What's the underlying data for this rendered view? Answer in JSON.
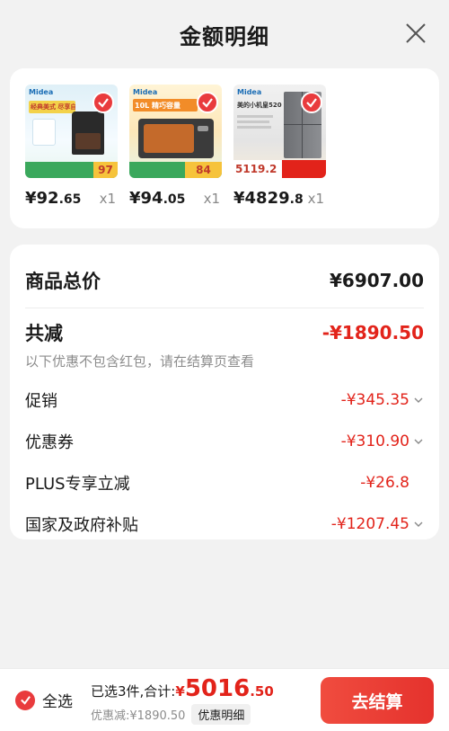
{
  "header": {
    "title": "金额明细"
  },
  "products": [
    {
      "price_int": "¥92",
      "price_dec": ".65",
      "qty": "x1",
      "brand": "Midea",
      "banner": "经典美式 尽享自制",
      "tag": "97"
    },
    {
      "price_int": "¥94",
      "price_dec": ".05",
      "qty": "x1",
      "brand": "Midea",
      "banner": "10L 精巧容量",
      "tag": "84"
    },
    {
      "price_int": "¥4829",
      "price_dec": ".8",
      "qty": "x1",
      "brand": "Midea",
      "banner": "美的小机皇520",
      "tag": "5119.2"
    }
  ],
  "summary": {
    "total_label": "商品总价",
    "total_value": "¥6907.00",
    "reduce_label": "共减",
    "reduce_value": "-¥1890.50",
    "note": "以下优惠不包含红包，请在结算页查看",
    "items": [
      {
        "label": "促销",
        "value": "-¥345.35"
      },
      {
        "label": "优惠券",
        "value": "-¥310.90"
      },
      {
        "label": "PLUS专享立减",
        "value": "-¥26.8"
      },
      {
        "label": "国家及政府补贴",
        "value": "-¥1207.45"
      }
    ]
  },
  "footer": {
    "select_all": "全选",
    "selected_text": "已选3件,合计:",
    "yen": "¥",
    "total_big": "5016",
    "total_small": ".50",
    "discount_text": "优惠减:¥1890.50",
    "detail_label": "优惠明细",
    "checkout_label": "去结算"
  },
  "colors": {
    "accent": "#e93b3d",
    "price_red": "#e2231a"
  }
}
